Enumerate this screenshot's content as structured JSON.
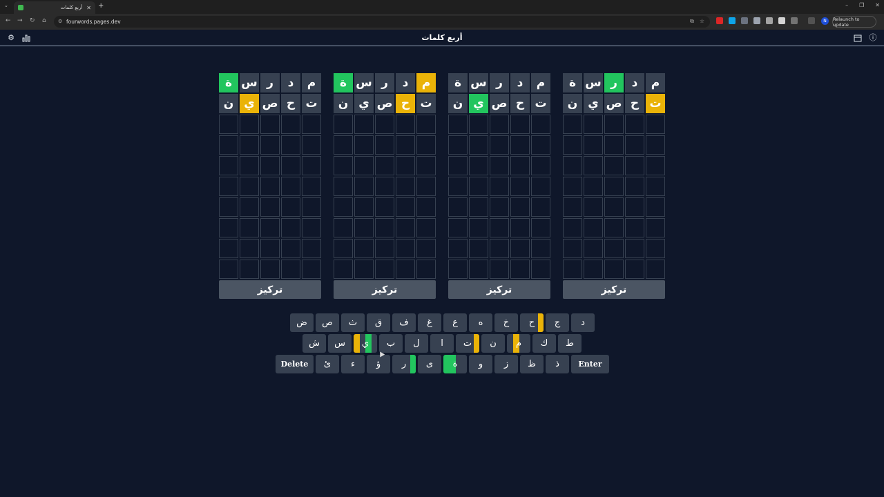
{
  "browser": {
    "tab_title": "أربع كلمات",
    "url": "fourwords.pages.dev",
    "relaunch_label": "Relaunch to update",
    "profile_initial": "N"
  },
  "app": {
    "title": "أربع كلمات"
  },
  "colors": {
    "correct": "#22c55e",
    "present": "#eab308",
    "filled": "#374151",
    "background": "#0f172a"
  },
  "focus_label": "تركيز",
  "boards": [
    {
      "rows": [
        [
          {
            "l": "ة",
            "s": "green"
          },
          {
            "l": "س",
            "s": "filled"
          },
          {
            "l": "ر",
            "s": "filled"
          },
          {
            "l": "د",
            "s": "filled"
          },
          {
            "l": "م",
            "s": "filled"
          }
        ],
        [
          {
            "l": "ن",
            "s": "filled"
          },
          {
            "l": "ي",
            "s": "yellow"
          },
          {
            "l": "ص",
            "s": "filled"
          },
          {
            "l": "ح",
            "s": "filled"
          },
          {
            "l": "ت",
            "s": "filled"
          }
        ]
      ]
    },
    {
      "rows": [
        [
          {
            "l": "ة",
            "s": "green"
          },
          {
            "l": "س",
            "s": "filled"
          },
          {
            "l": "ر",
            "s": "filled"
          },
          {
            "l": "د",
            "s": "filled"
          },
          {
            "l": "م",
            "s": "yellow"
          }
        ],
        [
          {
            "l": "ن",
            "s": "filled"
          },
          {
            "l": "ي",
            "s": "filled"
          },
          {
            "l": "ص",
            "s": "filled"
          },
          {
            "l": "ح",
            "s": "yellow"
          },
          {
            "l": "ت",
            "s": "filled"
          }
        ]
      ]
    },
    {
      "rows": [
        [
          {
            "l": "ة",
            "s": "filled"
          },
          {
            "l": "س",
            "s": "filled"
          },
          {
            "l": "ر",
            "s": "filled"
          },
          {
            "l": "د",
            "s": "filled"
          },
          {
            "l": "م",
            "s": "filled"
          }
        ],
        [
          {
            "l": "ن",
            "s": "filled"
          },
          {
            "l": "ي",
            "s": "green"
          },
          {
            "l": "ص",
            "s": "filled"
          },
          {
            "l": "ح",
            "s": "filled"
          },
          {
            "l": "ت",
            "s": "filled"
          }
        ]
      ]
    },
    {
      "rows": [
        [
          {
            "l": "ة",
            "s": "filled"
          },
          {
            "l": "س",
            "s": "filled"
          },
          {
            "l": "ر",
            "s": "green"
          },
          {
            "l": "د",
            "s": "filled"
          },
          {
            "l": "م",
            "s": "filled"
          }
        ],
        [
          {
            "l": "ن",
            "s": "filled"
          },
          {
            "l": "ي",
            "s": "filled"
          },
          {
            "l": "ص",
            "s": "filled"
          },
          {
            "l": "ح",
            "s": "filled"
          },
          {
            "l": "ت",
            "s": "yellow"
          }
        ]
      ]
    }
  ],
  "keyboard": {
    "row1": [
      {
        "k": "ض"
      },
      {
        "k": "ص"
      },
      {
        "k": "ث"
      },
      {
        "k": "ق"
      },
      {
        "k": "ف"
      },
      {
        "k": "غ"
      },
      {
        "k": "ع"
      },
      {
        "k": "ه"
      },
      {
        "k": "خ"
      },
      {
        "k": "ح",
        "marks": [
          {
            "board": 4,
            "c": "present"
          }
        ]
      },
      {
        "k": "ج"
      },
      {
        "k": "د"
      }
    ],
    "row2": [
      {
        "k": "ش"
      },
      {
        "k": "س"
      },
      {
        "k": "ي",
        "marks": [
          {
            "board": 1,
            "c": "present"
          },
          {
            "board": 3,
            "c": "correct"
          }
        ]
      },
      {
        "k": "ب"
      },
      {
        "k": "ل"
      },
      {
        "k": "ا"
      },
      {
        "k": "ت",
        "marks": [
          {
            "board": 4,
            "c": "present"
          }
        ]
      },
      {
        "k": "ن"
      },
      {
        "k": "م",
        "marks": [
          {
            "board": 2,
            "c": "present"
          }
        ]
      },
      {
        "k": "ك"
      },
      {
        "k": "ط"
      }
    ],
    "row3": [
      {
        "k": "Delete",
        "wide": true
      },
      {
        "k": "ئ"
      },
      {
        "k": "ء"
      },
      {
        "k": "ؤ"
      },
      {
        "k": "ر",
        "marks": [
          {
            "board": 4,
            "c": "correct"
          }
        ]
      },
      {
        "k": "ى"
      },
      {
        "k": "ة",
        "marks": [
          {
            "board": 1,
            "c": "correct"
          },
          {
            "board": 2,
            "c": "correct"
          }
        ]
      },
      {
        "k": "و"
      },
      {
        "k": "ز"
      },
      {
        "k": "ظ"
      },
      {
        "k": "ذ"
      },
      {
        "k": "Enter",
        "wide": true
      }
    ]
  }
}
